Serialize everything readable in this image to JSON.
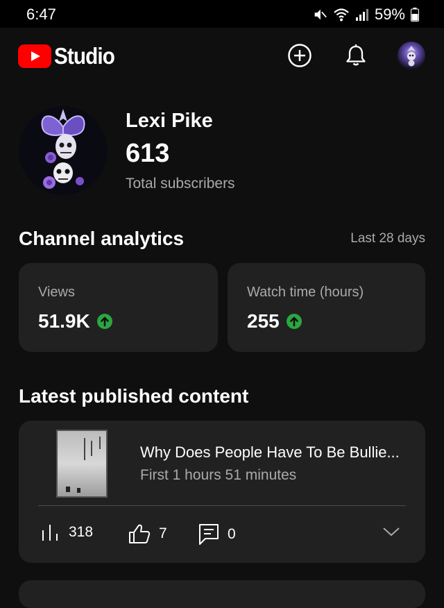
{
  "status_bar": {
    "time": "6:47",
    "battery": "59%"
  },
  "app_bar": {
    "logo_text": "Studio",
    "brand_color": "#ff0000"
  },
  "channel": {
    "name": "Lexi Pike",
    "subscribers": "613",
    "subscribers_label": "Total subscribers"
  },
  "analytics": {
    "title": "Channel analytics",
    "range": "Last 28 days",
    "views_label": "Views",
    "views_value": "51.9K",
    "watch_label": "Watch time (hours)",
    "watch_value": "255",
    "trend_color": "#2ba640"
  },
  "latest": {
    "title": "Latest published content",
    "video_title": "Why Does People Have To Be Bullie...",
    "video_subtitle": "First 1 hours 51 minutes",
    "views": "318",
    "likes": "7",
    "comments": "0"
  }
}
